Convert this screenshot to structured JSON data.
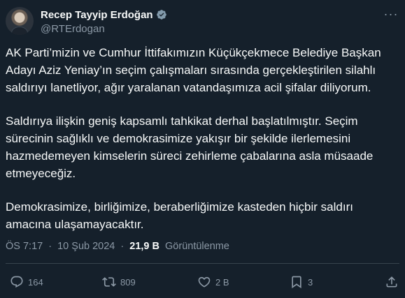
{
  "author": {
    "display_name": "Recep Tayyip Erdoğan",
    "handle": "@RTErdogan",
    "verified_icon": "verified-badge-icon",
    "avatar_icon": "profile-avatar"
  },
  "tweet": {
    "paragraphs": [
      "AK Parti’mizin ve Cumhur İttifakımızın Küçükçekmece Belediye Başkan Adayı Aziz Yeniay’ın seçim çalışmaları sırasında gerçekleştirilen silahlı saldırıyı lanetliyor, ağır yaralanan vatandaşımıza acil şifalar diliyorum.",
      "Saldırıya ilişkin geniş kapsamlı tahkikat derhal başlatılmıştır. Seçim sürecinin sağlıklı ve demokrasimize yakışır bir şekilde ilerlemesini hazmedemeyen kimselerin süreci zehirleme çabalarına asla müsaade etmeyeceğiz.",
      "Demokrasimize, birliğimize, beraberliğimize kasteden hiçbir saldırı amacına ulaşamayacaktır."
    ],
    "time": "ÖS 7:17",
    "separator": "·",
    "date": "10 Şub 2024",
    "views_count": "21,9 B",
    "views_label": "Görüntülenme"
  },
  "actions": {
    "reply_count": "164",
    "retweet_count": "809",
    "like_count": "2 B",
    "bookmark_count": "3",
    "icons": [
      "reply-icon",
      "retweet-icon",
      "like-icon",
      "bookmark-icon",
      "share-icon"
    ]
  },
  "colors": {
    "background": "#15202b",
    "text": "#f7f9f9",
    "muted": "#8b98a5",
    "verified": "#829aab",
    "divider": "#38444d"
  }
}
